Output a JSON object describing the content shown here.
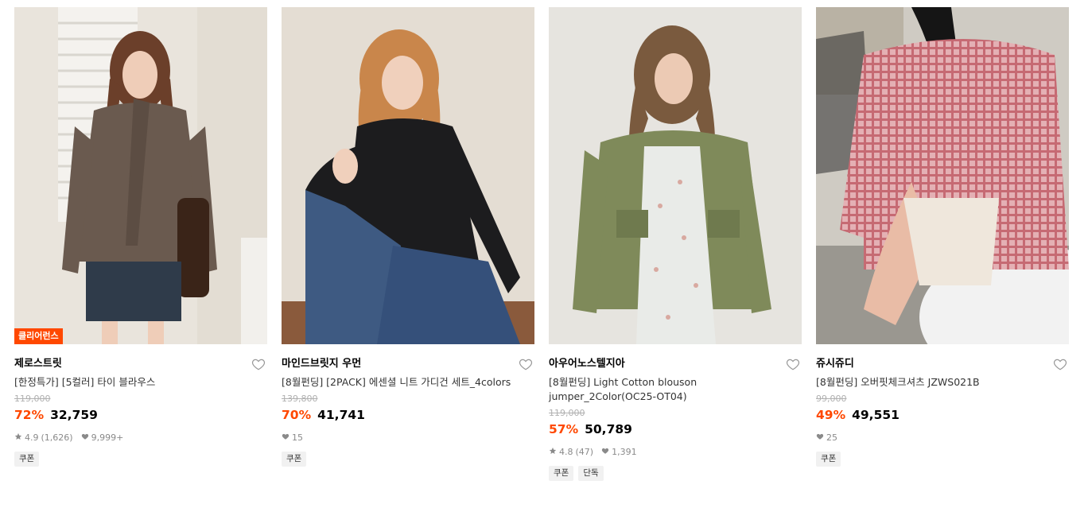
{
  "products": [
    {
      "badge": "클리어런스",
      "brand": "제로스트릿",
      "name": "[한정특가] [5컬러] 타이 블라우스",
      "original_price": "119,000",
      "discount": "72%",
      "price": "32,759",
      "rating": "4.9",
      "review_count": "(1,626)",
      "likes": "9,999+",
      "tags": [
        "쿠폰"
      ],
      "like_icon": "heart-outline-icon"
    },
    {
      "badge": "",
      "brand": "마인드브릿지 우먼",
      "name": "[8월펀딩] [2PACK] 에센셜 니트 가디건 세트_4colors",
      "original_price": "139,800",
      "discount": "70%",
      "price": "41,741",
      "rating": "",
      "review_count": "",
      "likes": "15",
      "tags": [
        "쿠폰"
      ],
      "like_icon": "heart-outline-icon"
    },
    {
      "badge": "",
      "brand": "아우어노스텔지아",
      "name_line1": "[8월펀딩] Light Cotton blouson",
      "name_line2": "jumper_2Color(OC25-OT04)",
      "original_price": "119,000",
      "discount": "57%",
      "price": "50,789",
      "rating": "4.8",
      "review_count": "(47)",
      "likes": "1,391",
      "tags": [
        "쿠폰",
        "단독"
      ],
      "like_icon": "heart-outline-icon"
    },
    {
      "badge": "",
      "brand": "쥬시쥬디",
      "name": "[8월펀딩] 오버핏체크셔츠 JZWS021B",
      "original_price": "99,000",
      "discount": "49%",
      "price": "49,551",
      "rating": "",
      "review_count": "",
      "likes": "25",
      "tags": [
        "쿠폰"
      ],
      "like_icon": "heart-outline-icon"
    }
  ],
  "colors": {
    "discount": "#ff4800",
    "badge_bg": "#ff4800",
    "tag_bg": "#f1f1f1",
    "meta_text": "#8a8a8a"
  }
}
